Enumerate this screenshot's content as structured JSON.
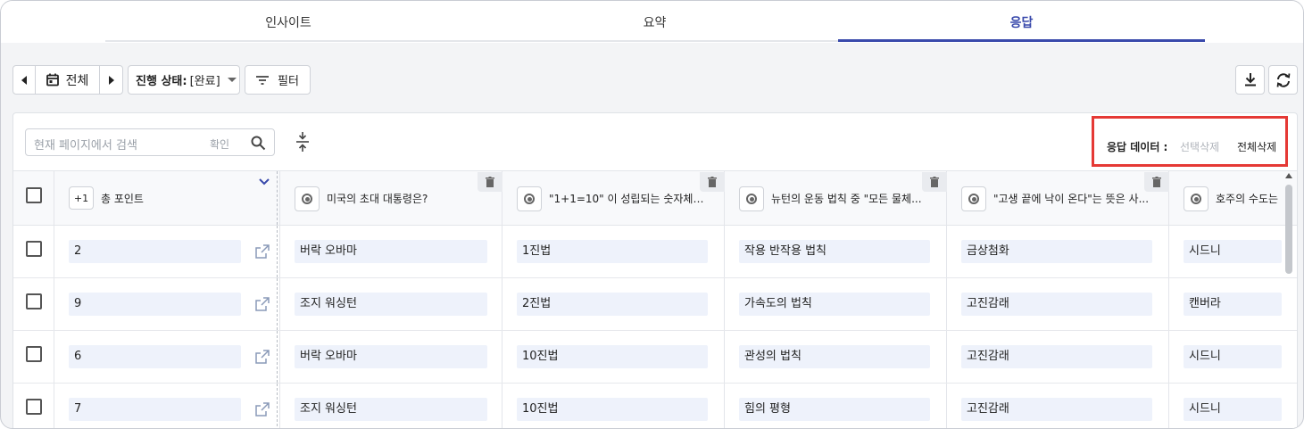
{
  "tabs": [
    {
      "label": "인사이트"
    },
    {
      "label": "요약"
    },
    {
      "label": "응답"
    }
  ],
  "toolbar": {
    "date_label": "전체",
    "status_label": "진행 상태:",
    "status_value": "[완료]",
    "filter_label": "필터"
  },
  "search": {
    "placeholder": "현재 페이지에서 검색",
    "confirm_label": "확인"
  },
  "response_data": {
    "label": "응답 데이터 :",
    "delete_selected": "선택삭제",
    "delete_all": "전체삭제"
  },
  "table": {
    "points_badge": "+1",
    "points_header": "총 포인트",
    "questions": [
      "미국의 초대 대통령은?",
      "\"1+1=10\" 이 성립되는 숫자체계...",
      "뉴턴의 운동 법칙 중 \"모든 물체...",
      "\"고생 끝에 낙이 온다\"는 뜻은 사...",
      "호주의 수도는"
    ],
    "rows": [
      {
        "points": "2",
        "answers": [
          "버락 오바마",
          "1진법",
          "작용 반작용 법칙",
          "금상첨화",
          "시드니"
        ]
      },
      {
        "points": "9",
        "answers": [
          "조지 워싱턴",
          "2진법",
          "가속도의 법칙",
          "고진감래",
          "캔버라"
        ]
      },
      {
        "points": "6",
        "answers": [
          "버락 오바마",
          "10진법",
          "관성의 법칙",
          "고진감래",
          "시드니"
        ]
      },
      {
        "points": "7",
        "answers": [
          "조지 워싱턴",
          "10진법",
          "힘의 평형",
          "고진감래",
          "시드니"
        ]
      }
    ]
  },
  "colors": {
    "accent": "#3949ab",
    "highlight_border": "#e53935",
    "cell_background": "#eef2fb"
  }
}
